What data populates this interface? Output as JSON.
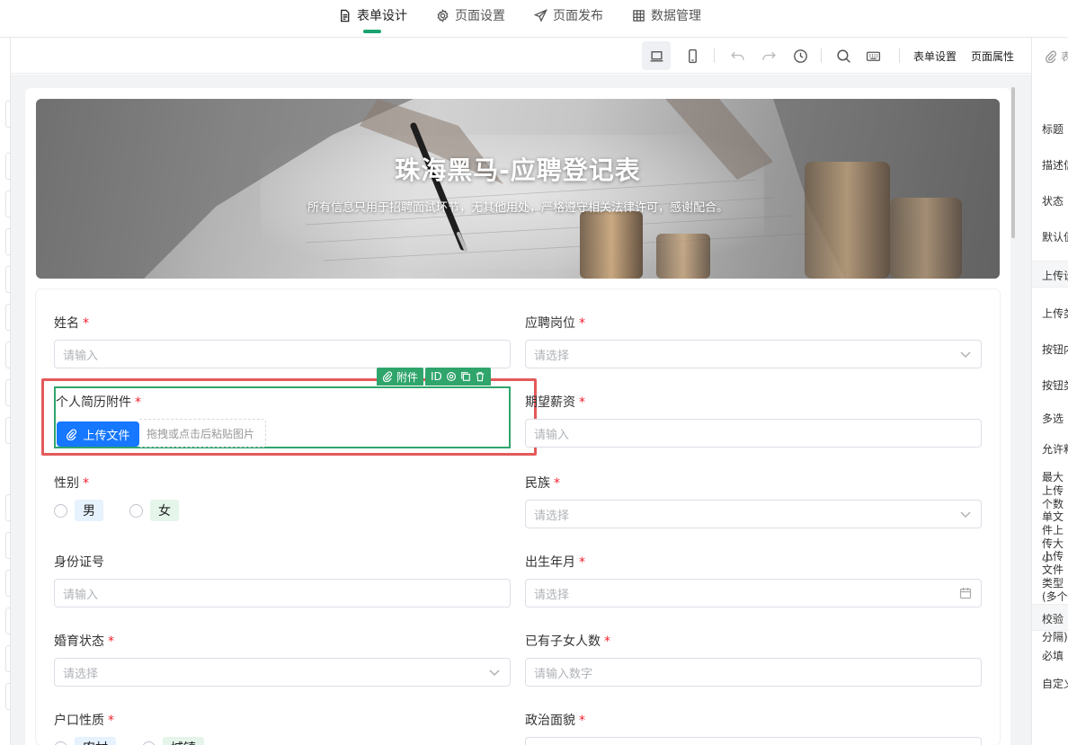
{
  "nav": {
    "tabs": [
      {
        "label": "表单设计",
        "icon": "document-icon",
        "active": true
      },
      {
        "label": "页面设置",
        "icon": "gear-icon",
        "active": false
      },
      {
        "label": "页面发布",
        "icon": "send-icon",
        "active": false
      },
      {
        "label": "数据管理",
        "icon": "table-icon",
        "active": false
      }
    ],
    "accent": "#1aa36f"
  },
  "toolbar": {
    "form_settings": "表单设置",
    "page_props": "页面属性"
  },
  "banner": {
    "title": "珠海黑马-应聘登记表",
    "subtitle": "所有信息只用于招聘面试环节，无其他用处，严格遵守相关法律许可，感谢配合。"
  },
  "form": {
    "name": {
      "label": "姓名",
      "placeholder": "请输入"
    },
    "position": {
      "label": "应聘岗位",
      "placeholder": "请选择"
    },
    "resume": {
      "label": "个人简历附件",
      "upload_label": "上传文件",
      "drop_hint": "拖拽或点击后粘贴图片"
    },
    "salary": {
      "label": "期望薪资",
      "placeholder": "请输入"
    },
    "gender": {
      "label": "性别",
      "options": [
        "男",
        "女"
      ]
    },
    "ethnicity": {
      "label": "民族",
      "placeholder": "请选择"
    },
    "id_number": {
      "label": "身份证号",
      "placeholder": "请输入"
    },
    "birth": {
      "label": "出生年月",
      "placeholder": "请选择"
    },
    "marital": {
      "label": "婚育状态",
      "placeholder": "请选择"
    },
    "children": {
      "label": "已有子女人数",
      "placeholder": "请输入数字"
    },
    "hukou": {
      "label": "户口性质",
      "options": [
        "农村",
        "城镇"
      ]
    },
    "political": {
      "label": "政治面貌"
    }
  },
  "selected_widget": {
    "type_label": "附件",
    "id_label": "ID",
    "color": "#2fa56c"
  },
  "highlight_color": "#e35a5a",
  "right_panel": {
    "tab": "表单",
    "items": [
      "标题",
      "描述信息",
      "状态",
      "默认值"
    ],
    "upload_section": "上传设置",
    "upload_items": [
      "上传类型",
      "按钮内容",
      "按钮类型",
      "多选",
      "允许粘贴",
      "最大上传个数",
      "单文件上传大小",
      "上传文件类型(多个用逗号，分隔)"
    ],
    "validate_section": "校验",
    "validate_items": [
      "必填",
      "自定义"
    ]
  }
}
